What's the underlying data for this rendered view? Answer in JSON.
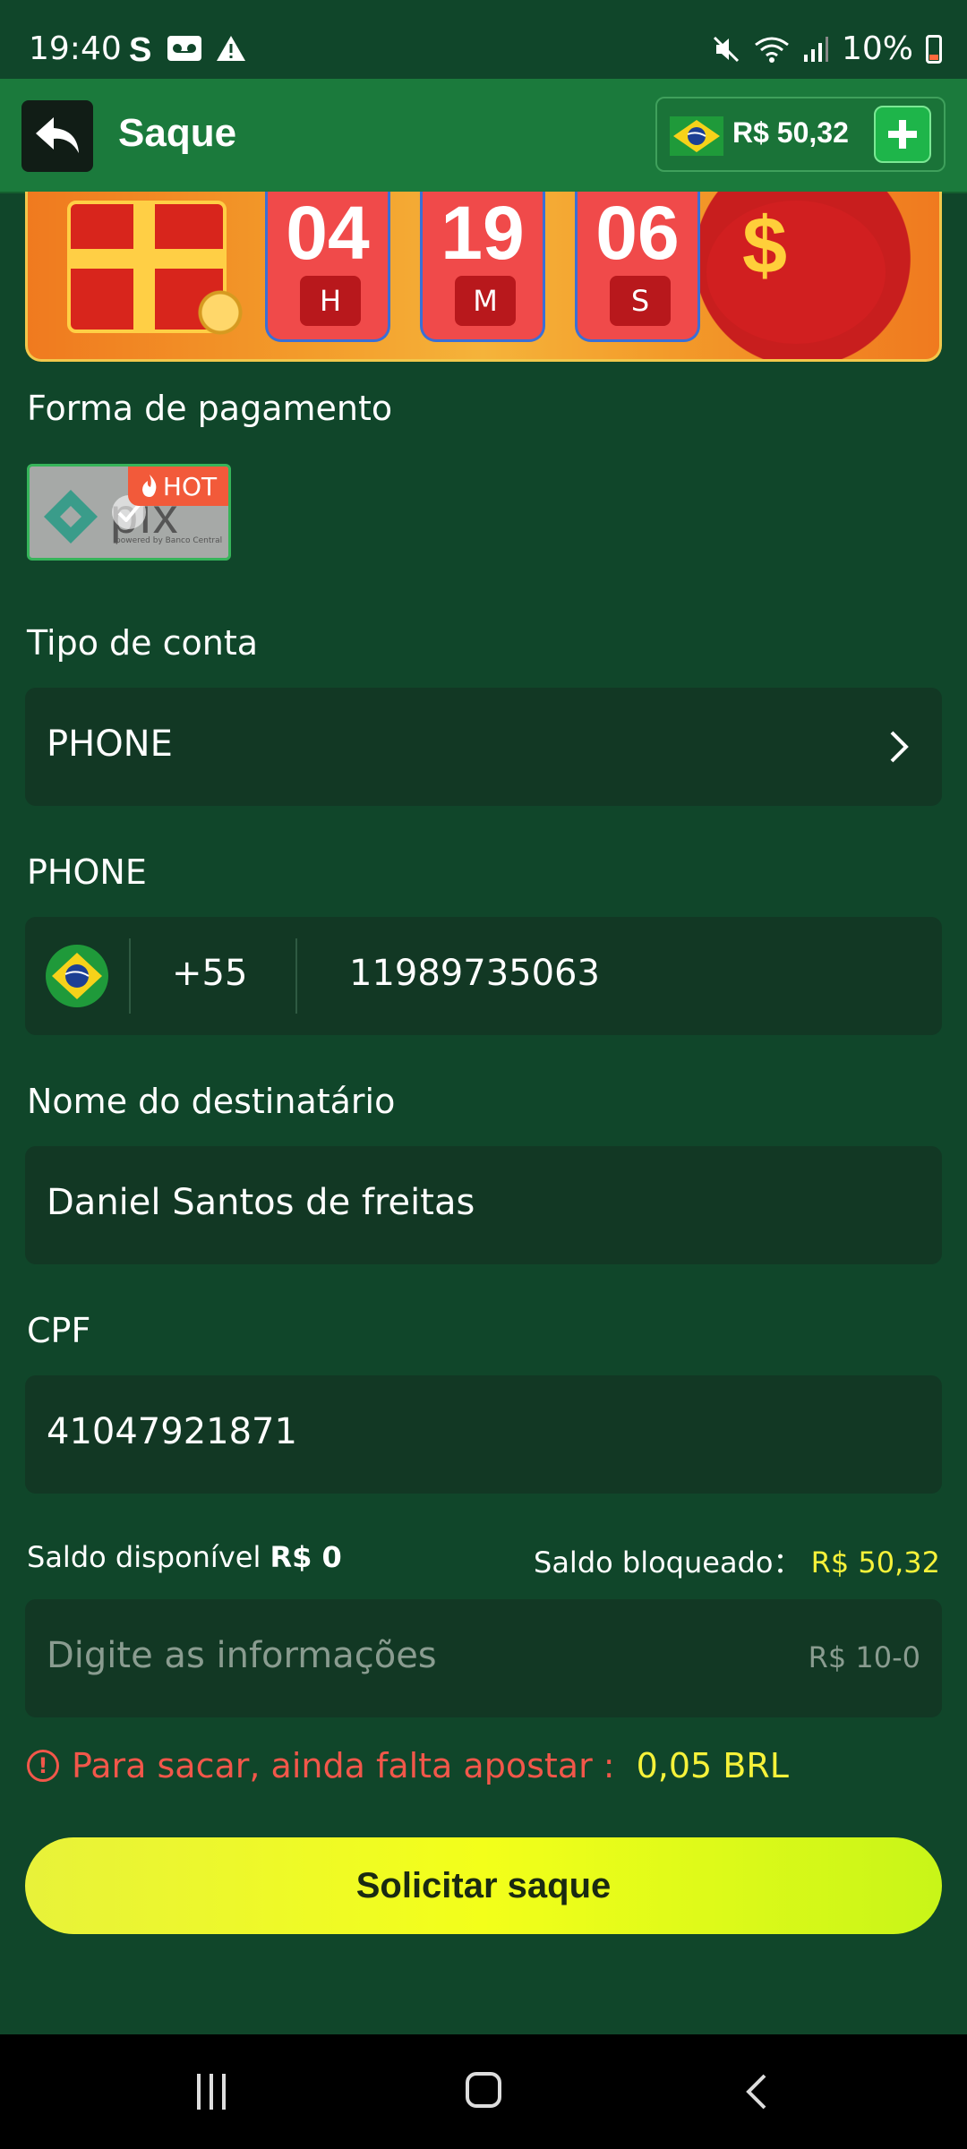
{
  "status_bar": {
    "time": "19:40",
    "battery": "10%"
  },
  "header": {
    "title": "Saque",
    "balance": "R$ 50,32"
  },
  "timer": {
    "hours": "04",
    "hours_unit": "H",
    "minutes": "19",
    "minutes_unit": "M",
    "seconds": "06",
    "seconds_unit": "S"
  },
  "payment": {
    "label": "Forma de pagamento",
    "method_hot": "HOT",
    "method_logo_text": "pix",
    "method_logo_sub": "powered by Banco Central"
  },
  "account_type": {
    "label": "Tipo de conta",
    "value": "PHONE"
  },
  "phone": {
    "label": "PHONE",
    "country_code": "+55",
    "number": "11989735063"
  },
  "recipient": {
    "label": "Nome do destinatário",
    "value": "Daniel Santos de freitas"
  },
  "cpf": {
    "label": "CPF",
    "value": "41047921871"
  },
  "balances": {
    "available_label": "Saldo disponível",
    "available_value": "R$ 0",
    "blocked_label": "Saldo bloqueado：",
    "blocked_value": "R$ 50,32"
  },
  "amount": {
    "placeholder": "Digite as informações",
    "range": "R$ 10-0"
  },
  "warning": {
    "text": "Para sacar, ainda falta apostar :",
    "amount": "0,05 BRL"
  },
  "submit": {
    "label": "Solicitar saque"
  },
  "colors": {
    "background": "#10462a",
    "header": "#1b7a3c",
    "accent_yellow": "#f6f23a",
    "warning_red": "#f2574a"
  }
}
